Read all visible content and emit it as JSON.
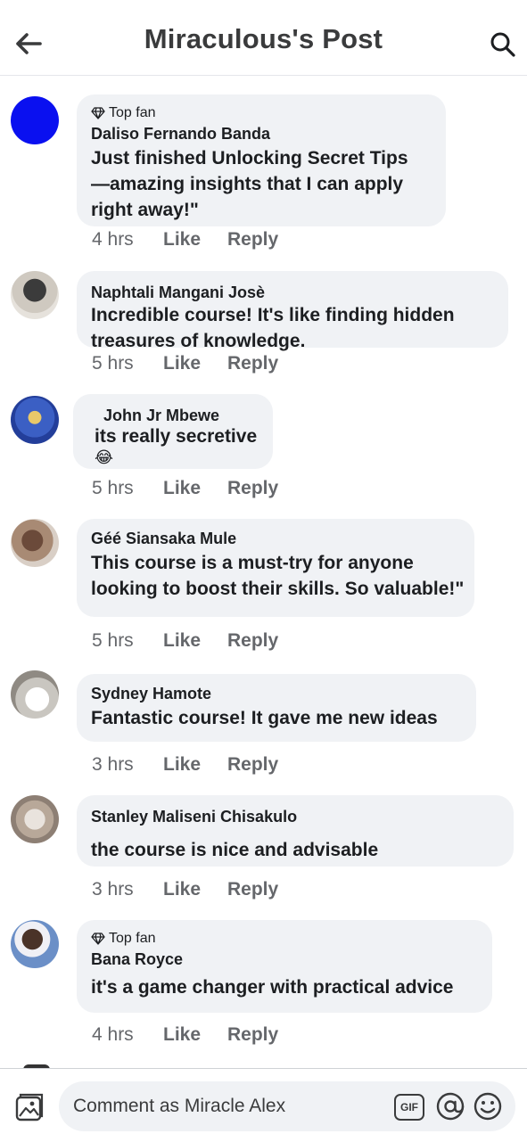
{
  "header": {
    "title": "Miraculous's Post"
  },
  "comments": [
    {
      "top_fan": "Top fan",
      "author": "Daliso Fernando Banda",
      "text": "Just finished Unlocking Secret Tips —amazing insights that I can apply right away!\"",
      "time": "4 hrs",
      "like": "Like",
      "reply": "Reply"
    },
    {
      "author": "Naphtali Mangani Josè",
      "text": "Incredible course! It's like finding hidden treasures of knowledge.",
      "time": "5 hrs",
      "like": "Like",
      "reply": "Reply"
    },
    {
      "author": "John Jr Mbewe",
      "text": "its really secretive",
      "emoji": "😂",
      "time": "5 hrs",
      "like": "Like",
      "reply": "Reply"
    },
    {
      "author": "Géé Siansaka Mule",
      "text": "This course is a must-try for anyone looking to boost their skills. So valuable!\"",
      "time": "5 hrs",
      "like": "Like",
      "reply": "Reply"
    },
    {
      "author": "Sydney Hamote",
      "text": "Fantastic course! It gave me new ideas",
      "time": "3 hrs",
      "like": "Like",
      "reply": "Reply"
    },
    {
      "author": "Stanley Maliseni Chisakulo",
      "text": "the course is nice and advisable",
      "time": "3 hrs",
      "like": "Like",
      "reply": "Reply"
    },
    {
      "top_fan": "Top fan",
      "author": "Bana Royce",
      "text": "it's a game changer with practical advice",
      "time": "4 hrs",
      "like": "Like",
      "reply": "Reply"
    }
  ],
  "composer": {
    "placeholder": "Comment as Miracle Alex",
    "gif_label": "GIF"
  },
  "colors": {
    "bubble": "#f0f2f5",
    "first_avatar": "#0a10f0",
    "meta_text": "#65676b"
  },
  "icons": {
    "back": "arrow-left-icon",
    "search": "search-icon",
    "top_fan": "diamond-icon",
    "photo": "photo-icon",
    "gif": "gif-icon",
    "mention": "at-icon",
    "emoji": "smiley-icon"
  }
}
